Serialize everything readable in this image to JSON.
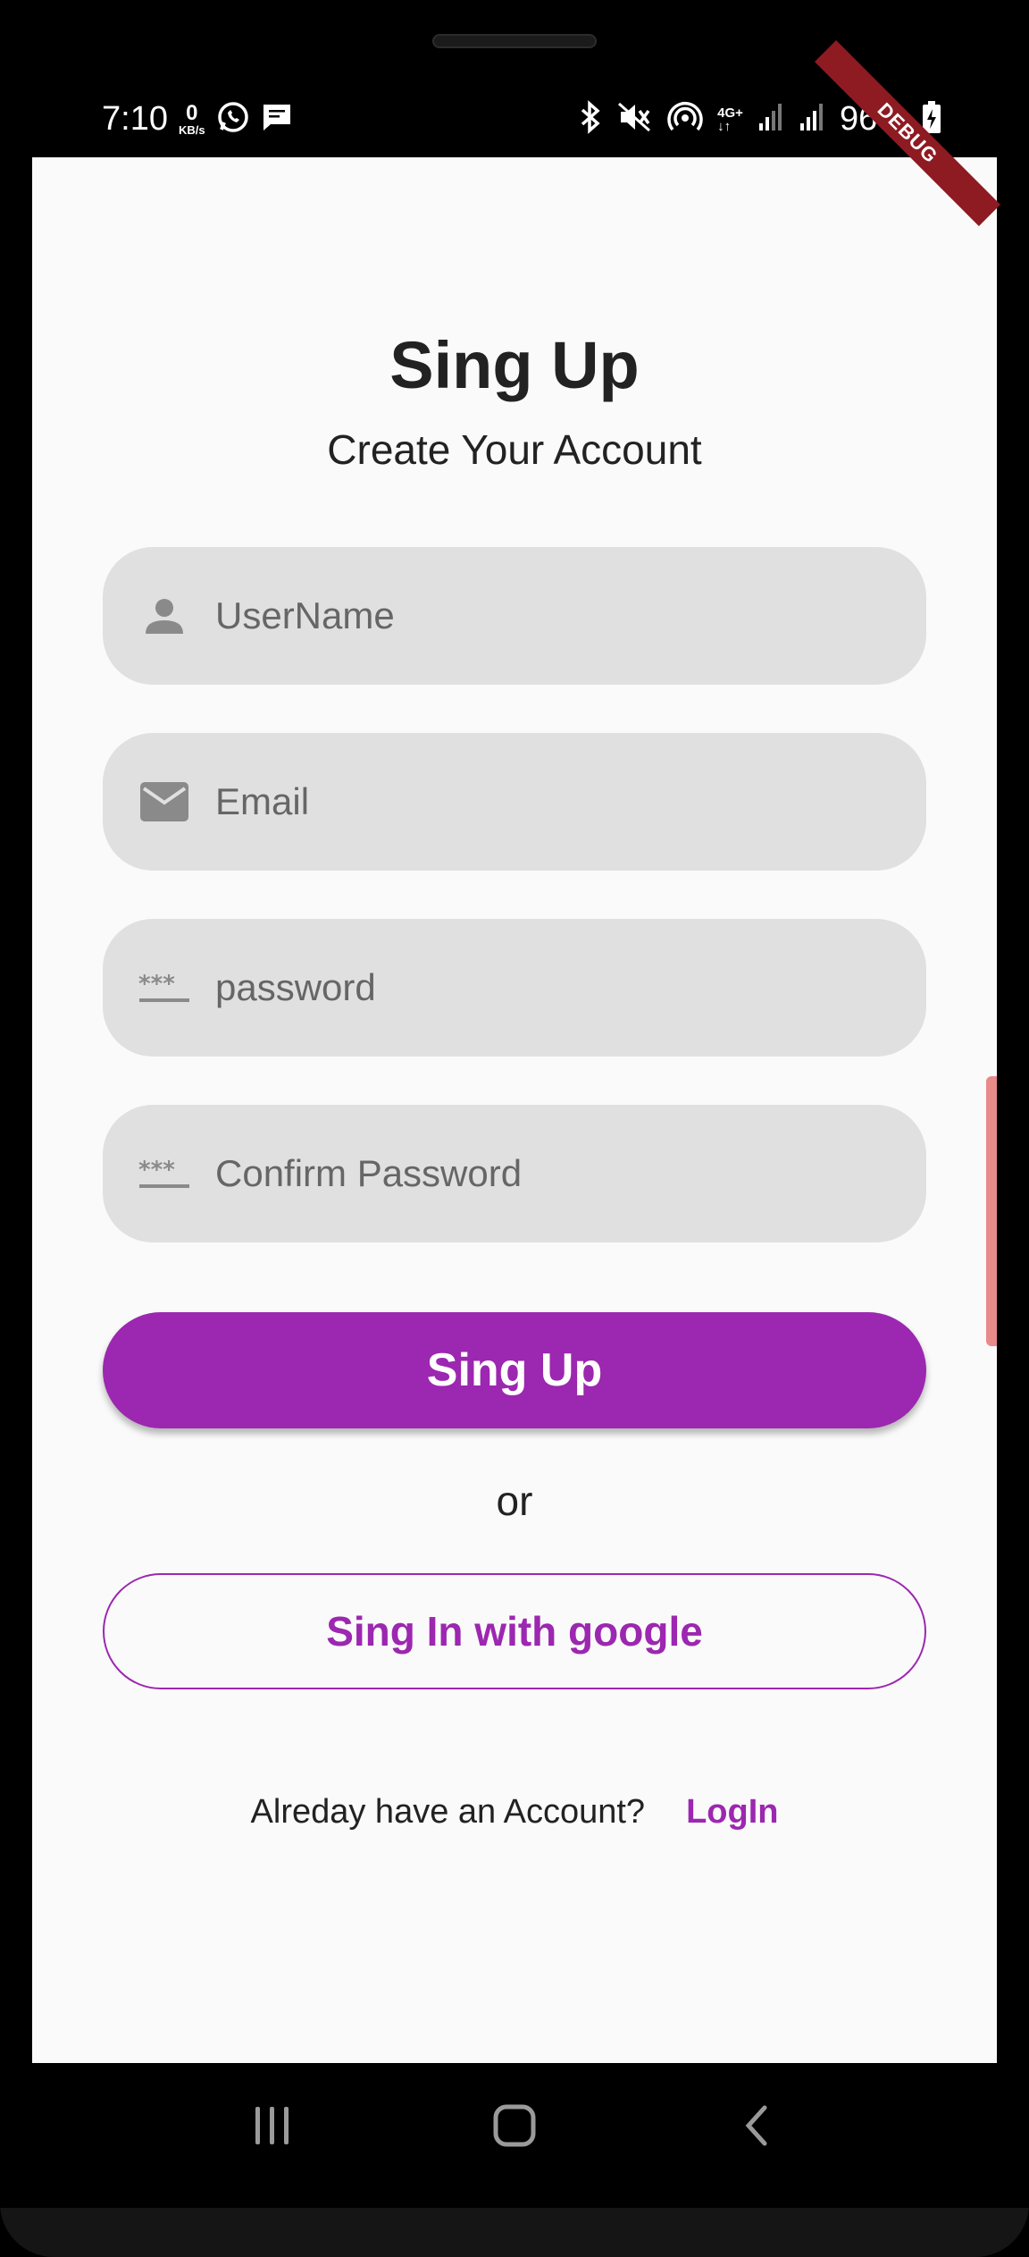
{
  "status_bar": {
    "time": "7:10",
    "net_speed_value": "0",
    "net_speed_unit": "KB/s",
    "network_type": "4G+",
    "battery_percent": "96%"
  },
  "debug_banner": "DEBUG",
  "header": {
    "title": "Sing Up",
    "subtitle": "Create Your Account"
  },
  "form": {
    "username_placeholder": "UserName",
    "email_placeholder": "Email",
    "password_placeholder": "password",
    "confirm_password_placeholder": "Confirm Password",
    "signup_button": "Sing Up",
    "or_text": "or",
    "google_button": "Sing In with google"
  },
  "footer": {
    "question": "Alreday have an Account?",
    "login_link": "LogIn"
  },
  "colors": {
    "accent": "#9c27b0",
    "field_bg": "#e0e0e0",
    "screen_bg": "#fafafa"
  }
}
